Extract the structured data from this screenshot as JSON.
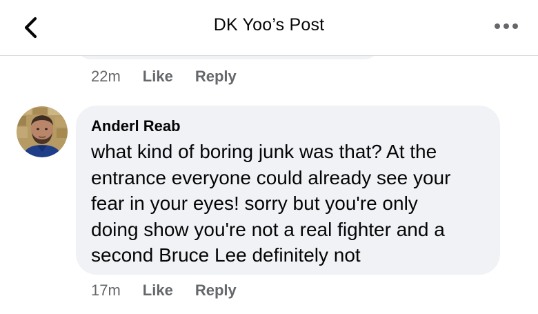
{
  "header": {
    "title": "DK Yoo’s Post",
    "back_icon": "chevron-left-icon",
    "more_icon": "ellipsis-icon"
  },
  "previous_comment": {
    "time": "22m",
    "like_label": "Like",
    "reply_label": "Reply"
  },
  "comment": {
    "author": "Anderl Reab",
    "lines": [
      "what kind of boring junk was that?  At the",
      "entrance everyone could already see your",
      "fear in your eyes!  sorry but you're only",
      "doing show you're not a real fighter and a",
      "second Bruce Lee definitely not"
    ],
    "time": "17m",
    "like_label": "Like",
    "reply_label": "Reply"
  },
  "colors": {
    "bubble": "#f0f2f5",
    "meta_text": "#65676b",
    "primary_text": "#050505"
  }
}
